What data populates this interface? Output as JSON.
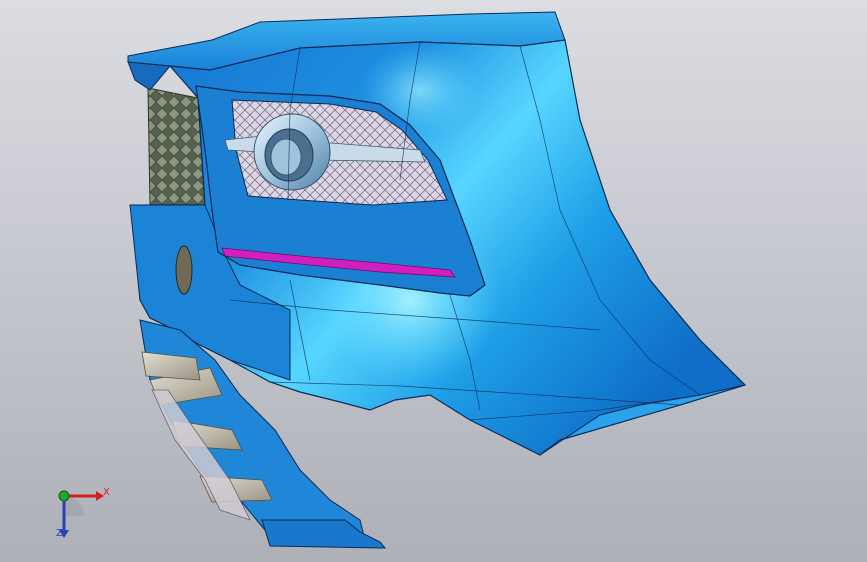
{
  "viewport": {
    "background_top": "#dcdde2",
    "background_bottom": "#aeb0b8"
  },
  "model": {
    "body_color": "#1e8fe0",
    "highlight_color": "#57d6ff",
    "shadow_color": "#0f5fb0",
    "edge_color": "#0b2a55",
    "grille_color": "#6e7a6c",
    "fog_mesh_color": "#d7d2de",
    "trim_strip_color": "#d11fc2",
    "lower_guard_color": "#c9c3b5"
  },
  "triad": {
    "x_label": "X",
    "z_label": "Z",
    "x_color": "#d21f1f",
    "y_color": "#1fa82d",
    "z_color": "#2a3fb8"
  }
}
